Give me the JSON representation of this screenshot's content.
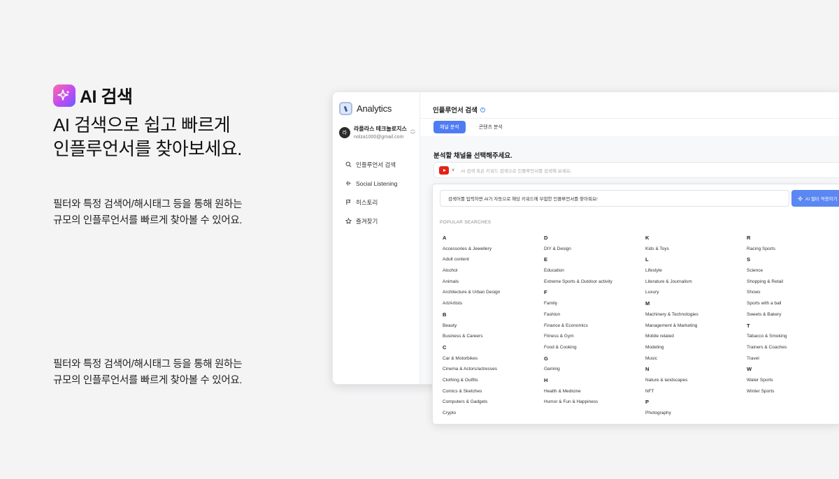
{
  "hero": {
    "badge_title": "AI 검색",
    "headline_1": "AI 검색으로 쉽고 빠르게",
    "headline_2": "인플루언서를 찾아보세요.",
    "desc1_line1": "필터와 특정 검색어/해시태그 등을 통해 원하는",
    "desc1_line2": "규모의 인플루언서를 빠르게 찾아볼 수 있어요.",
    "desc2_line1": "필터와 특정 검색어/해시태그 등을 통해 원하는",
    "desc2_line2": "규모의 인플루언서를 빠르게 찾아볼 수 있어요."
  },
  "app": {
    "brand": "Analytics",
    "account": {
      "avatar": "라",
      "name": "라플라스 테크놀로지스",
      "email": "nolza1000@gmail.com"
    },
    "nav": [
      {
        "label": "인플루언서 검색",
        "icon": "search-icon"
      },
      {
        "label": "Social Listening",
        "icon": "waveform-icon"
      },
      {
        "label": "히스토리",
        "icon": "flag-icon"
      },
      {
        "label": "즐겨찾기",
        "icon": "star-icon"
      }
    ],
    "page_title": "인플루언서 검색",
    "tabs": [
      "채널 분석",
      "콘텐츠 분석"
    ],
    "section_title": "분석할 채널을 선택해주세요.",
    "search_placeholder": "AI 검색 혹은 키워드 검색으로 인플루언서를 검색해 보세요.",
    "platform_icon": "youtube-icon"
  },
  "panel": {
    "ai_input_text": "검색어를 입력하면 AI가 자동으로 해당 키워드에 부합한 인플루언서를 찾아줘요!",
    "ai_button": "AI 필터 적용하기",
    "popular_label": "POPULAR SEARCHES",
    "columns": [
      [
        {
          "letter": "A",
          "items": [
            "Accessories & Jewellery",
            "Adult content",
            "Alcohol",
            "Animals",
            "Architecture & Urban Design",
            "Art/Artists"
          ]
        },
        {
          "letter": "B",
          "items": [
            "Beauty",
            "Business & Careers"
          ]
        },
        {
          "letter": "C",
          "items": [
            "Car & Motorbikes",
            "Cinema & Actors/actresses",
            "Clothing & Outfits",
            "Comics & Sketches",
            "Computers & Gadgets",
            "Crypto"
          ]
        }
      ],
      [
        {
          "letter": "D",
          "items": [
            "DIY & Design"
          ]
        },
        {
          "letter": "E",
          "items": [
            "Education",
            "Extreme Sports & Outdoor activity"
          ]
        },
        {
          "letter": "F",
          "items": [
            "Family",
            "Fashion",
            "Finance & Economics",
            "Fitness & Gym",
            "Food & Cooking"
          ]
        },
        {
          "letter": "G",
          "items": [
            "Gaming"
          ]
        },
        {
          "letter": "H",
          "items": [
            "Health & Medicine",
            "Humor & Fun & Happiness"
          ]
        }
      ],
      [
        {
          "letter": "K",
          "items": [
            "Kids & Toys"
          ]
        },
        {
          "letter": "L",
          "items": [
            "Lifestyle",
            "Literature & Journalism",
            "Luxury"
          ]
        },
        {
          "letter": "M",
          "items": [
            "Machinery & Technologies",
            "Management & Marketing",
            "Mobile related",
            "Modeling",
            "Music"
          ]
        },
        {
          "letter": "N",
          "items": [
            "Nature & landscapes",
            "NFT"
          ]
        },
        {
          "letter": "P",
          "items": [
            "Photography"
          ]
        }
      ],
      [
        {
          "letter": "R",
          "items": [
            "Racing Sports"
          ]
        },
        {
          "letter": "S",
          "items": [
            "Science",
            "Shopping & Retail",
            "Shows",
            "Sports with a ball",
            "Sweets & Bakery"
          ]
        },
        {
          "letter": "T",
          "items": [
            "Tabacco & Smoking",
            "Trainers & Coaches",
            "Travel"
          ]
        },
        {
          "letter": "W",
          "items": [
            "Water Sports",
            "Winter Sports"
          ]
        }
      ]
    ]
  },
  "colors": {
    "accent": "#4f7cf5",
    "badge_gradient_start": "#ff6aa8",
    "badge_gradient_end": "#6a5cff",
    "youtube_red": "#e62117"
  }
}
